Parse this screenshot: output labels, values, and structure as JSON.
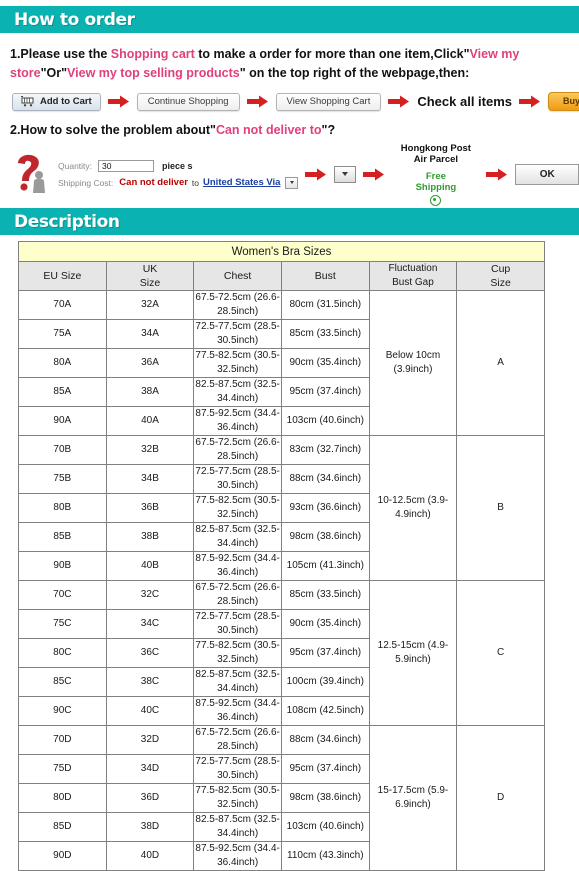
{
  "sections": {
    "how_to_order": {
      "title": "How to order"
    },
    "description": {
      "title": "Description"
    }
  },
  "step1": {
    "part1": "1.Please use the ",
    "hl1": "Shopping cart",
    "part2": " to make a order for more than one item,Click\"",
    "hl2": "View my store",
    "part3": "\"Or\"",
    "hl3": "View my top selling products",
    "part4": "\" on the top right of the webpage,then:"
  },
  "flow": {
    "add_to_cart": "Add to Cart",
    "continue_shopping": "Continue Shopping",
    "view_shopping_cart": "View Shopping Cart",
    "check_all_items": "Check all items",
    "buy_now": "Buy Now"
  },
  "step2": {
    "part1": "2.How to solve the problem about\"",
    "hl1": "Can not deliver to",
    "part2": "\"?"
  },
  "shipping": {
    "quantity_label": "Quantity:",
    "quantity_value": "30",
    "piece_text": "piece s",
    "shipping_cost_label": "Shipping Cost:",
    "cannot_deliver": "Can not deliver",
    "to_word": "to",
    "country": "United States Via",
    "carrier_line1": "Hongkong Post",
    "carrier_line2": "Air Parcel",
    "free_line1": "Free",
    "free_line2": "Shipping",
    "ok_button": "OK"
  },
  "size_table": {
    "title": "Women's Bra Sizes",
    "headers": {
      "eu": "EU Size",
      "uk_line1": "UK",
      "uk_line2": "Size",
      "chest": "Chest",
      "bust": "Bust",
      "fluct_line1": "Fluctuation",
      "fluct_line2": "Bust Gap",
      "cup_line1": "Cup",
      "cup_line2": "Size"
    },
    "groups": [
      {
        "cup": "A",
        "fluctuation": "Below 10cm (3.9inch)",
        "rows": [
          {
            "eu": "70A",
            "uk": "32A",
            "chest": "67.5-72.5cm (26.6-28.5inch)",
            "bust": "80cm (31.5inch)"
          },
          {
            "eu": "75A",
            "uk": "34A",
            "chest": "72.5-77.5cm (28.5-30.5inch)",
            "bust": "85cm (33.5inch)"
          },
          {
            "eu": "80A",
            "uk": "36A",
            "chest": "77.5-82.5cm (30.5-32.5inch)",
            "bust": "90cm (35.4inch)"
          },
          {
            "eu": "85A",
            "uk": "38A",
            "chest": "82.5-87.5cm (32.5-34.4inch)",
            "bust": "95cm (37.4inch)"
          },
          {
            "eu": "90A",
            "uk": "40A",
            "chest": "87.5-92.5cm (34.4-36.4inch)",
            "bust": "103cm (40.6inch)"
          }
        ]
      },
      {
        "cup": "B",
        "fluctuation": "10-12.5cm (3.9-4.9inch)",
        "rows": [
          {
            "eu": "70B",
            "uk": "32B",
            "chest": "67.5-72.5cm (26.6-28.5inch)",
            "bust": "83cm (32.7inch)"
          },
          {
            "eu": "75B",
            "uk": "34B",
            "chest": "72.5-77.5cm (28.5-30.5inch)",
            "bust": "88cm (34.6inch)"
          },
          {
            "eu": "80B",
            "uk": "36B",
            "chest": "77.5-82.5cm (30.5-32.5inch)",
            "bust": "93cm (36.6inch)"
          },
          {
            "eu": "85B",
            "uk": "38B",
            "chest": "82.5-87.5cm (32.5-34.4inch)",
            "bust": "98cm (38.6inch)"
          },
          {
            "eu": "90B",
            "uk": "40B",
            "chest": "87.5-92.5cm (34.4-36.4inch)",
            "bust": "105cm (41.3inch)"
          }
        ]
      },
      {
        "cup": "C",
        "fluctuation": "12.5-15cm (4.9-5.9inch)",
        "rows": [
          {
            "eu": "70C",
            "uk": "32C",
            "chest": "67.5-72.5cm (26.6-28.5inch)",
            "bust": "85cm (33.5inch)"
          },
          {
            "eu": "75C",
            "uk": "34C",
            "chest": "72.5-77.5cm (28.5-30.5inch)",
            "bust": "90cm (35.4inch)"
          },
          {
            "eu": "80C",
            "uk": "36C",
            "chest": "77.5-82.5cm (30.5-32.5inch)",
            "bust": "95cm (37.4inch)"
          },
          {
            "eu": "85C",
            "uk": "38C",
            "chest": "82.5-87.5cm (32.5-34.4inch)",
            "bust": "100cm (39.4inch)"
          },
          {
            "eu": "90C",
            "uk": "40C",
            "chest": "87.5-92.5cm (34.4-36.4inch)",
            "bust": "108cm (42.5inch)"
          }
        ]
      },
      {
        "cup": "D",
        "fluctuation": "15-17.5cm (5.9-6.9inch)",
        "rows": [
          {
            "eu": "70D",
            "uk": "32D",
            "chest": "67.5-72.5cm (26.6-28.5inch)",
            "bust": "88cm (34.6inch)"
          },
          {
            "eu": "75D",
            "uk": "34D",
            "chest": "72.5-77.5cm (28.5-30.5inch)",
            "bust": "95cm (37.4inch)"
          },
          {
            "eu": "80D",
            "uk": "36D",
            "chest": "77.5-82.5cm (30.5-32.5inch)",
            "bust": "98cm (38.6inch)"
          },
          {
            "eu": "85D",
            "uk": "38D",
            "chest": "82.5-87.5cm (32.5-34.4inch)",
            "bust": "103cm (40.6inch)"
          },
          {
            "eu": "90D",
            "uk": "40D",
            "chest": "87.5-92.5cm (34.4-36.4inch)",
            "bust": "110cm (43.3inch)"
          }
        ]
      }
    ]
  },
  "colors": {
    "teal": "#0bb2b2",
    "pink": "#e0407c",
    "arrow_red": "#d42020",
    "table_title_bg": "#ffffcc",
    "green": "#2f9c2f"
  }
}
